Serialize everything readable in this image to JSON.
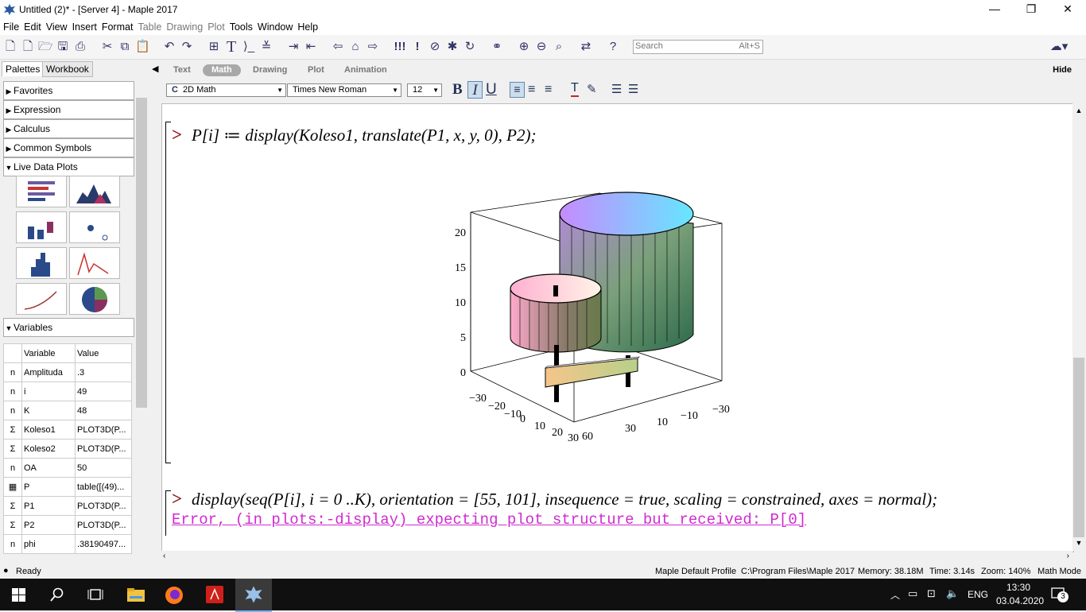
{
  "window": {
    "title": "Untitled (2)* - [Server 4] - Maple 2017",
    "controls": {
      "minimize": "—",
      "maximize": "❐",
      "close": "✕"
    }
  },
  "menu": [
    "File",
    "Edit",
    "View",
    "Insert",
    "Format",
    "Table",
    "Drawing",
    "Plot",
    "Tools",
    "Window",
    "Help"
  ],
  "menu_dimmed": [
    "Table",
    "Drawing",
    "Plot"
  ],
  "search": {
    "placeholder": "Search",
    "shortcut": "Alt+S"
  },
  "palette_tabs": [
    "Palettes",
    "Workbook"
  ],
  "palette_sections": [
    "Favorites",
    "Expression",
    "Calculus",
    "Common Symbols",
    "Live Data Plots"
  ],
  "variables_section": "Variables",
  "variables_headers": [
    "Variable",
    "Value"
  ],
  "variables": [
    {
      "type": "n",
      "name": "Amplituda",
      "value": ".3"
    },
    {
      "type": "n",
      "name": "i",
      "value": "49"
    },
    {
      "type": "n",
      "name": "K",
      "value": "48"
    },
    {
      "type": "Σ",
      "name": "Koleso1",
      "value": "PLOT3D(P..."
    },
    {
      "type": "Σ",
      "name": "Koleso2",
      "value": "PLOT3D(P..."
    },
    {
      "type": "n",
      "name": "OA",
      "value": "50"
    },
    {
      "type": "▦",
      "name": "P",
      "value": "table([(49)..."
    },
    {
      "type": "Σ",
      "name": "P1",
      "value": "PLOT3D(P..."
    },
    {
      "type": "Σ",
      "name": "P2",
      "value": "PLOT3D(P..."
    },
    {
      "type": "n",
      "name": "phi",
      "value": ".38190497..."
    }
  ],
  "context_tabs": [
    "Text",
    "Math",
    "Drawing",
    "Plot",
    "Animation"
  ],
  "context_active": "Math",
  "hide_label": "Hide",
  "format": {
    "mode": "2D Math",
    "mode_prefix": "C",
    "font": "Times New Roman",
    "size": "12"
  },
  "doc": {
    "prompt": ">",
    "line1": "P[i] ≔ display(Koleso1, translate(P1, x, y, 0), P2);",
    "line2": "display(seq(P[i], i = 0 ..K), orientation = [55, 101], insequence = true, scaling = constrained, axes = normal);",
    "error": "Error, (in plots:-display) expecting plot structure but received: P[0]"
  },
  "plot_axes": {
    "z_ticks": [
      "0",
      "5",
      "10",
      "15",
      "20"
    ],
    "x_ticks": [
      "−30",
      "−20",
      "−10",
      "0",
      "10",
      "20",
      "30"
    ],
    "y_ticks": [
      "60",
      "30",
      "10",
      "−10",
      "−30"
    ]
  },
  "status": {
    "ready": "Ready",
    "profile": "Maple Default Profile",
    "path": "C:\\Program Files\\Maple 2017",
    "memory": "Memory: 38.18M",
    "time": "Time: 3.14s",
    "zoom": "Zoom: 140%",
    "mode": "Math Mode"
  },
  "taskbar": {
    "lang": "ENG",
    "clock": "13:30",
    "date": "03.04.2020",
    "notifications": "3"
  }
}
